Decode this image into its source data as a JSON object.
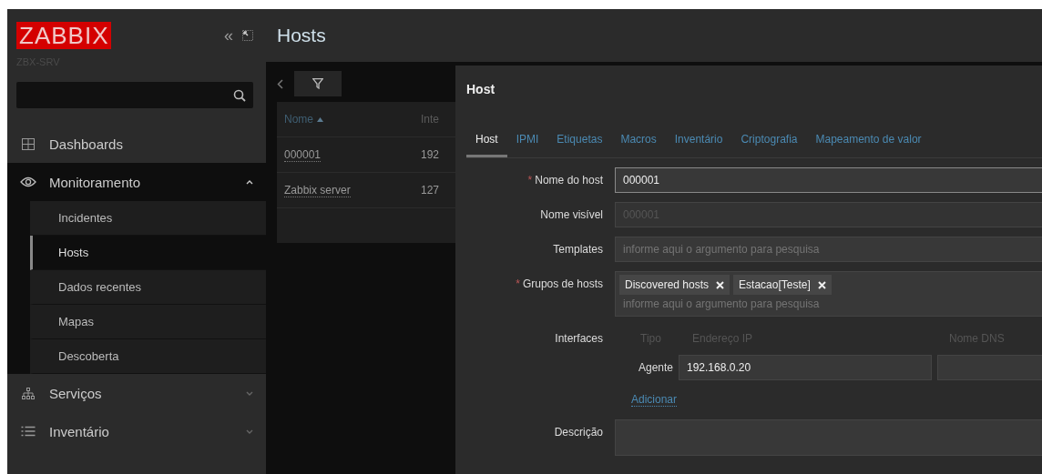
{
  "sidebar": {
    "logo": "ZABBIX",
    "server": "ZBX-SRV",
    "collapse": "«",
    "menu": [
      {
        "label": "Dashboards",
        "expanded": false,
        "has_caret": false
      },
      {
        "label": "Monitoramento",
        "expanded": true,
        "has_caret": true,
        "children": [
          {
            "label": "Incidentes",
            "selected": false
          },
          {
            "label": "Hosts",
            "selected": true
          },
          {
            "label": "Dados recentes",
            "selected": false
          },
          {
            "label": "Mapas",
            "selected": false
          },
          {
            "label": "Descoberta",
            "selected": false
          }
        ]
      },
      {
        "label": "Serviços",
        "expanded": false,
        "has_caret": true
      },
      {
        "label": "Inventário",
        "expanded": false,
        "has_caret": true
      }
    ]
  },
  "page": {
    "title": "Hosts",
    "table": {
      "columns": [
        {
          "label": "Nome",
          "sorted": true
        },
        {
          "label": "Inte",
          "sorted": false
        }
      ],
      "rows": [
        [
          "000001",
          "192"
        ],
        [
          "Zabbix server",
          "127"
        ]
      ]
    }
  },
  "dialog": {
    "title": "Host",
    "tabs": [
      {
        "label": "Host",
        "selected": true
      },
      {
        "label": "IPMI",
        "selected": false
      },
      {
        "label": "Etiquetas",
        "selected": false
      },
      {
        "label": "Macros",
        "selected": false
      },
      {
        "label": "Inventário",
        "selected": false
      },
      {
        "label": "Criptografia",
        "selected": false
      },
      {
        "label": "Mapeamento de valor",
        "selected": false
      }
    ],
    "fields": [
      {
        "kind": "text",
        "label": "Nome do host",
        "required_mark": "*",
        "value": "000001",
        "disabled": false
      },
      {
        "kind": "text",
        "label": "Nome visível",
        "value": "000001",
        "disabled": true
      },
      {
        "kind": "multiselect",
        "label": "Templates",
        "placeholder": "informe aqui o argumento para pesquisa"
      },
      {
        "kind": "multiselect",
        "label": "Grupos de hosts",
        "required_mark": "*",
        "tags": [
          "Discovered hosts",
          "Estacao[Teste]"
        ],
        "placeholder": "informe aqui o argumento para pesquisa"
      },
      {
        "kind": "interfaces",
        "label": "Interfaces",
        "headers": [
          "Tipo",
          "Endereço IP",
          "Nome DNS"
        ],
        "rows": [
          {
            "type": "Agente",
            "ip": "192.168.0.20"
          }
        ],
        "add": "Adicionar"
      },
      {
        "kind": "textarea",
        "label": "Descrição"
      }
    ]
  }
}
